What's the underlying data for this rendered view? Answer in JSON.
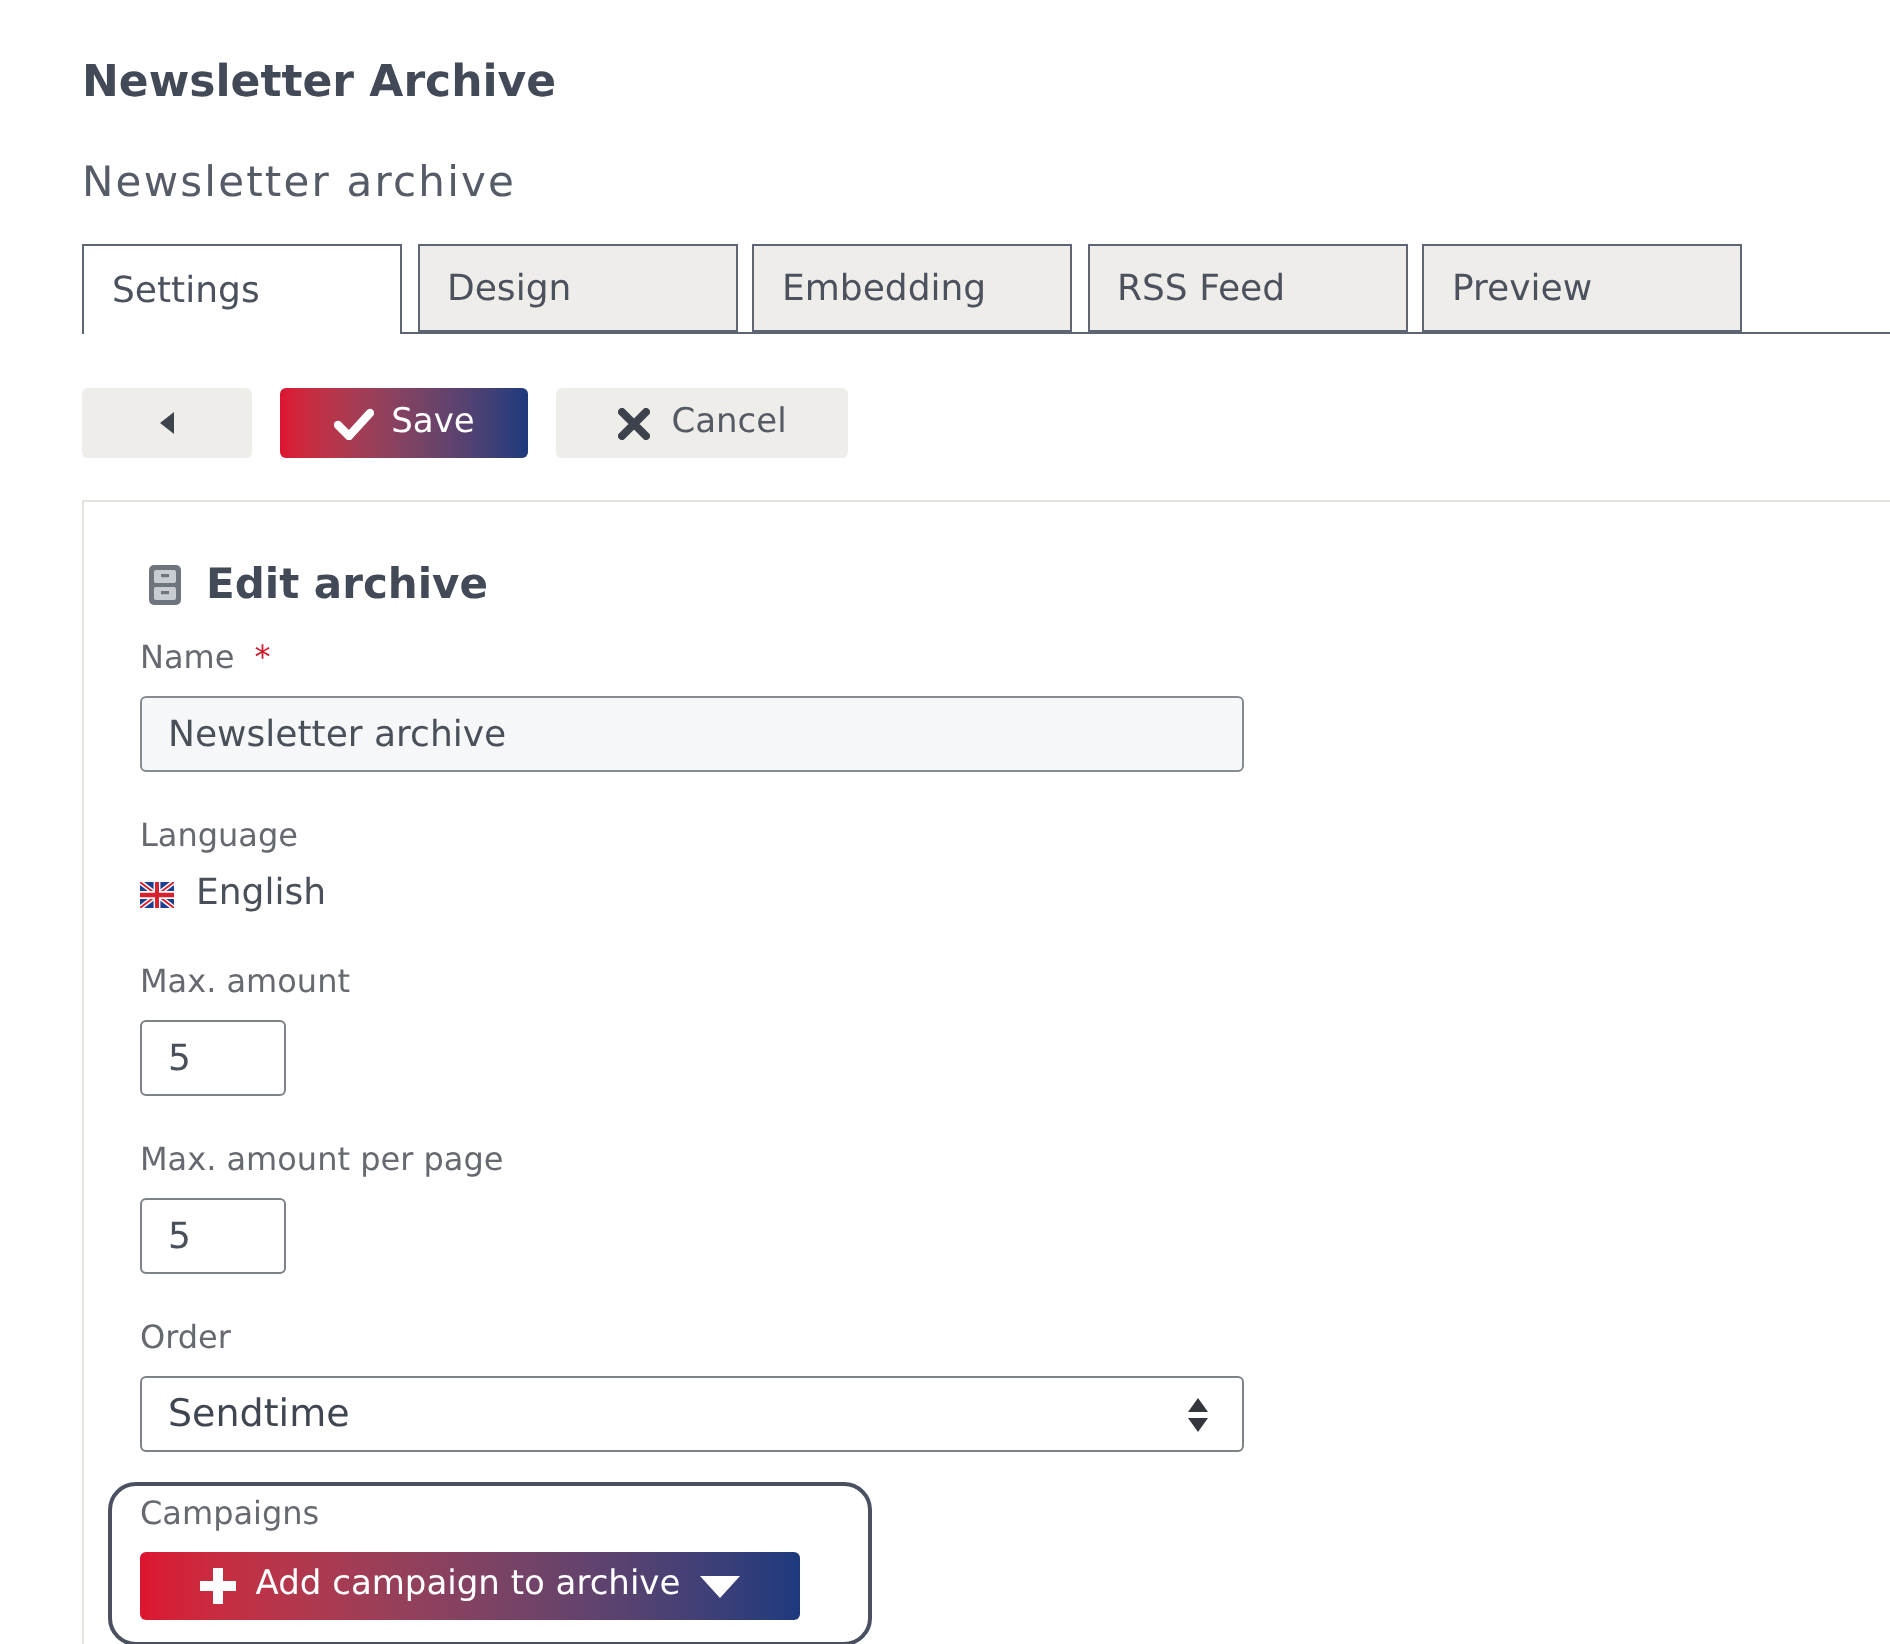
{
  "header": {
    "title": "Newsletter Archive",
    "subtitle": "Newsletter archive"
  },
  "tabs": [
    {
      "label": "Settings",
      "selected": true
    },
    {
      "label": "Design",
      "selected": false
    },
    {
      "label": "Embedding",
      "selected": false
    },
    {
      "label": "RSS Feed",
      "selected": false
    },
    {
      "label": "Preview",
      "selected": false
    }
  ],
  "toolbar": [
    {
      "kind": "back"
    },
    {
      "kind": "save",
      "label": "Save"
    },
    {
      "kind": "cancel",
      "label": "Cancel"
    }
  ],
  "panel": {
    "heading": "Edit archive",
    "fields": [
      {
        "kind": "text",
        "label": "Name",
        "required_mark": "*",
        "value": "Newsletter archive"
      },
      {
        "kind": "language",
        "label": "Language",
        "value": "English"
      },
      {
        "kind": "number",
        "label": "Max. amount",
        "value": "5"
      },
      {
        "kind": "number",
        "label": "Max. amount per page",
        "value": "5"
      },
      {
        "kind": "select",
        "label": "Order",
        "value": "Sendtime"
      }
    ],
    "campaigns": {
      "label": "Campaigns",
      "button": "Add campaign to archive",
      "highlighted": true
    }
  }
}
